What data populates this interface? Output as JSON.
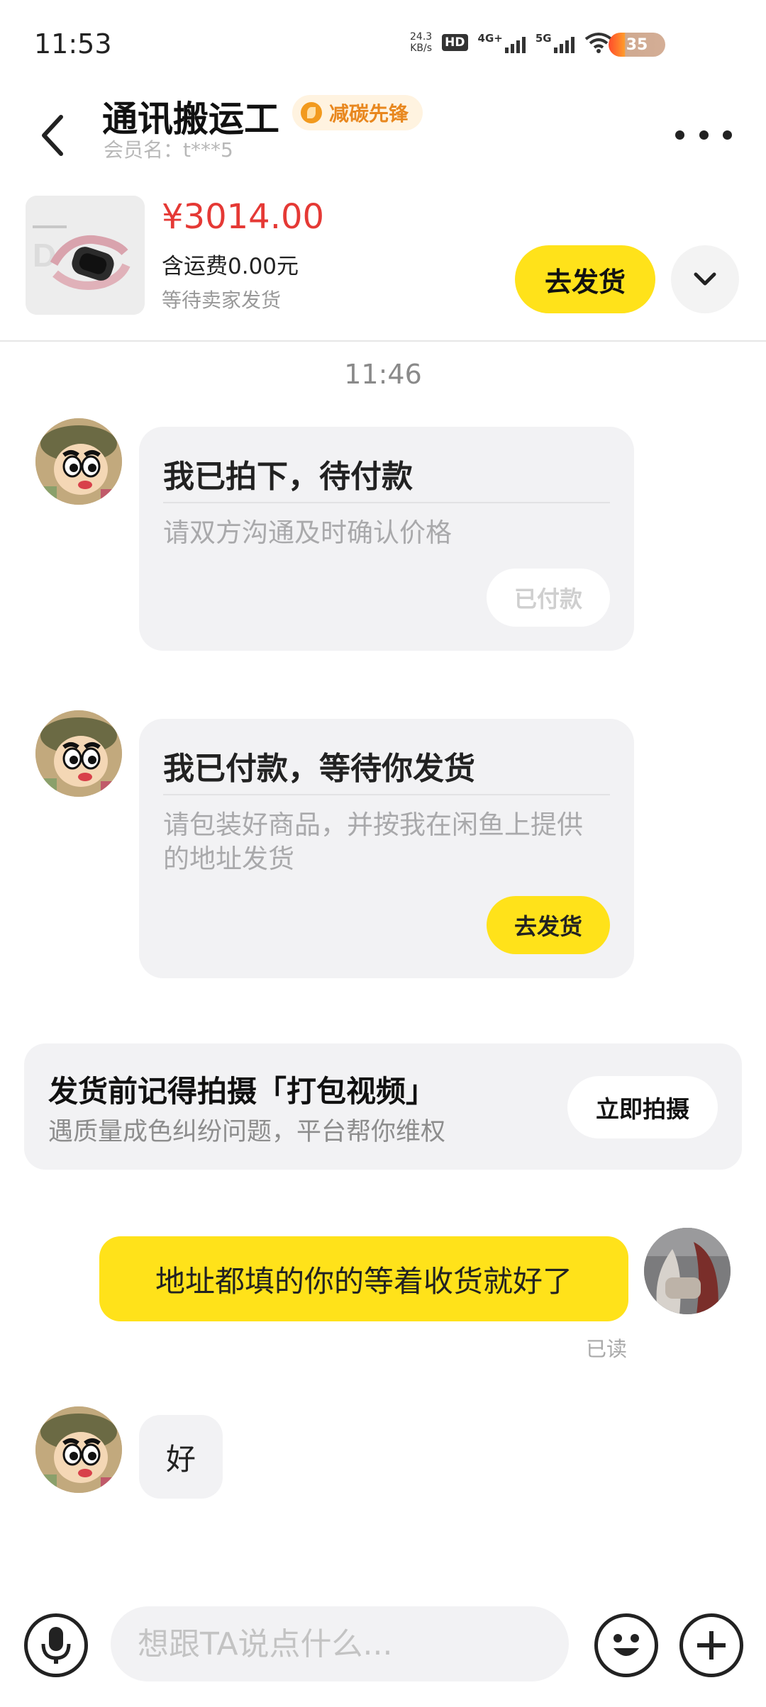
{
  "status_bar": {
    "time": "11:53",
    "net_speed_value": "24.3",
    "net_speed_unit": "KB/s",
    "hd_label": "HD",
    "sim1_label": "4G+",
    "sim2_label": "5G",
    "battery": "35"
  },
  "header": {
    "seller_name": "通讯搬运工",
    "badge": "减碳先锋",
    "member_label": "会员名：t***5"
  },
  "product": {
    "price": "¥3014.00",
    "shipping": "含运费0.00元",
    "status": "等待卖家发货",
    "ship_button": "去发货"
  },
  "chat": {
    "timestamp": "11:46",
    "card1": {
      "title": "我已拍下，待付款",
      "desc": "请双方沟通及时确认价格",
      "button": "已付款"
    },
    "card2": {
      "title": "我已付款，等待你发货",
      "desc": "请包装好商品，并按我在闲鱼上提供的地址发货",
      "button": "去发货"
    },
    "tip": {
      "title": "发货前记得拍摄「打包视频」",
      "subtitle": "遇质量成色纠纷问题，平台帮你维权",
      "button": "立即拍摄"
    },
    "my_message": "地址都填的你的等着收货就好了",
    "read_receipt": "已读",
    "reply": "好"
  },
  "input_bar": {
    "placeholder": "想跟TA说点什么..."
  },
  "colors": {
    "accent_yellow": "#ffe21a",
    "price_red": "#e53935",
    "badge_orange": "#e8871e"
  }
}
